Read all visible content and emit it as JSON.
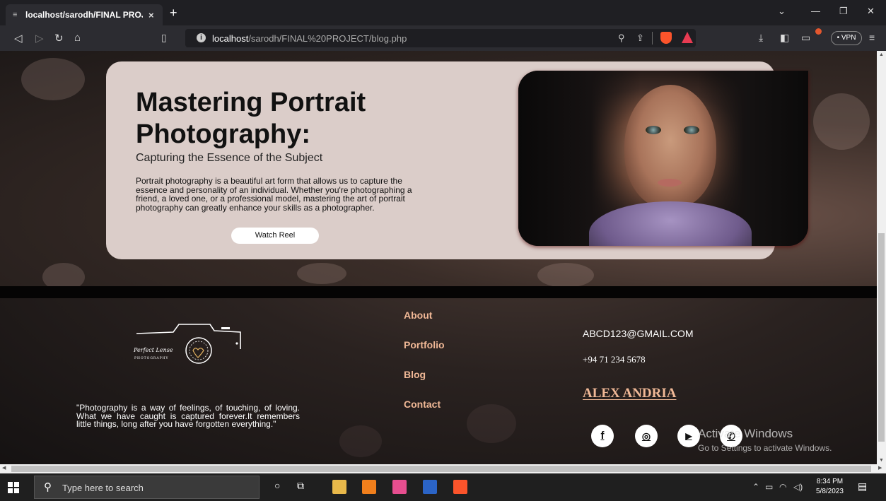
{
  "browser": {
    "tab_title": "localhost/sarodh/FINAL PROJECT",
    "tab_close": "×",
    "new_tab": "+",
    "url_host": "localhost",
    "url_path": "/sarodh/FINAL%20PROJECT/blog.php",
    "vpn_label": "• VPN"
  },
  "hero": {
    "title": "Mastering Portrait Photography:",
    "subtitle": "Capturing the Essence of the Subject",
    "paragraph": "Portrait photography is a beautiful art form that allows us to capture the essence and personality of an individual. Whether you're photographing a friend, a loved one, or a professional model, mastering the art of portrait photography can greatly enhance your skills as a photographer.",
    "button_label": "Watch Reel"
  },
  "footer": {
    "logo_script": "Perfect Lense",
    "logo_caption": "PHOTOGRAPHY",
    "quote": "\"Photography is a way of feelings, of touching, of loving. What we have caught is captured forever.It remembers little things, long after you have forgotten everything.\"",
    "nav": [
      "About",
      "Portfolio",
      "Blog",
      "Contact"
    ],
    "email": "ABCD123@GMAIL.COM",
    "phone": "+94 71 234 5678",
    "name": "ALEX ANDRIA",
    "social": [
      {
        "icon": "facebook-icon",
        "glyph": "f"
      },
      {
        "icon": "instagram-icon",
        "glyph": "◎"
      },
      {
        "icon": "youtube-icon",
        "glyph": "▶"
      },
      {
        "icon": "whatsapp-icon",
        "glyph": "✆"
      }
    ]
  },
  "watermark": {
    "title": "Activate Windows",
    "subtitle": "Go to Settings to activate Windows."
  },
  "taskbar": {
    "search_placeholder": "Type here to search",
    "time": "8:34 PM",
    "date": "5/8/2023"
  },
  "colors": {
    "card_bg": "#dbcdc9",
    "accent_link": "#f0b896",
    "footer_bg": "#1b1515"
  }
}
